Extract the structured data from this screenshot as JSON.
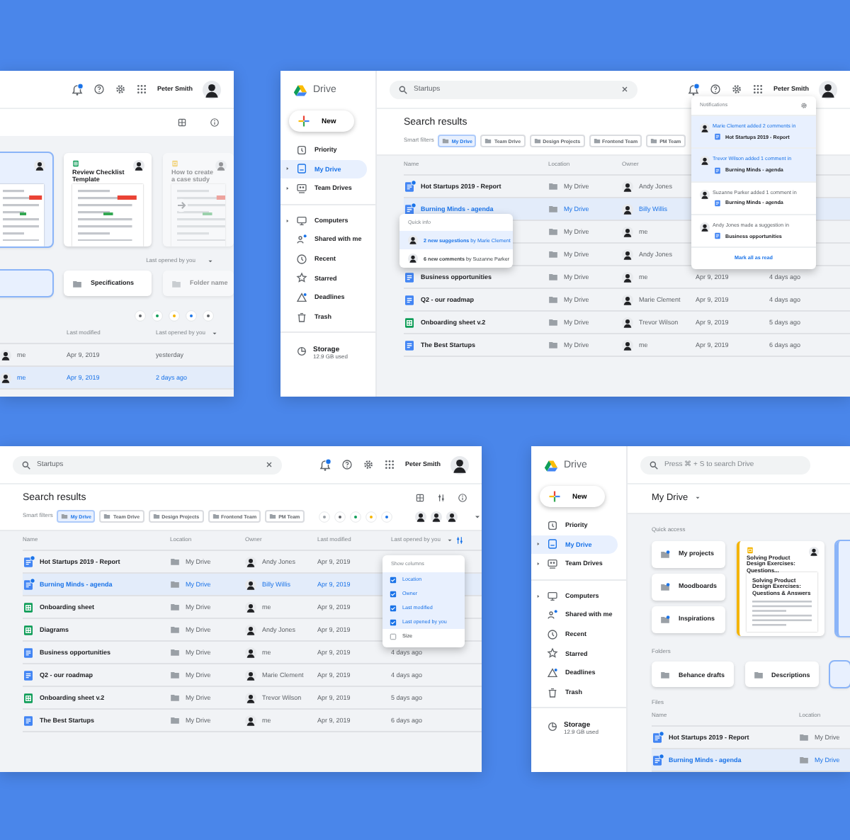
{
  "panels": [
    {
      "kind": "home_partial",
      "user": "Peter Smith",
      "cards": [
        {
          "selected": true
        },
        {
          "title": "Review Checklist Template",
          "kind": "sheet",
          "selected": false,
          "faded": false
        },
        {
          "title": "How to create a case study",
          "kind": "slides",
          "selected": false,
          "faded": true
        }
      ],
      "sort": "Last opened by you",
      "folders": [
        {
          "selected": true
        },
        {
          "name": "Specifications",
          "selected": false,
          "faded": false
        },
        {
          "name": "Folder name",
          "selected": false,
          "faded": true
        }
      ],
      "table": {
        "columns": [
          "Last modified",
          "Last opened by you"
        ],
        "rows": [
          {
            "owner": "me",
            "modified": "Apr 9, 2019",
            "opened": "yesterday",
            "selected": false
          },
          {
            "owner": "me",
            "modified": "Apr 9, 2019",
            "opened": "2 days ago",
            "selected": true
          }
        ]
      }
    },
    {
      "kind": "search_notifications",
      "user": "Peter Smith",
      "sidebar": {
        "logo": "Drive",
        "new": "New",
        "groups": [
          [
            {
              "label": "Priority",
              "selected": false,
              "expandable": false
            },
            {
              "label": "My Drive",
              "selected": true,
              "expandable": true
            },
            {
              "label": "Team Drives",
              "selected": false,
              "expandable": true
            }
          ],
          [
            {
              "label": "Computers",
              "selected": false,
              "expandable": true
            },
            {
              "label": "Shared with me",
              "selected": false,
              "expandable": false
            },
            {
              "label": "Recent",
              "selected": false,
              "expandable": false
            },
            {
              "label": "Starred",
              "selected": false,
              "expandable": false
            },
            {
              "label": "Deadlines",
              "selected": false,
              "expandable": false
            },
            {
              "label": "Trash",
              "selected": false,
              "expandable": false
            }
          ]
        ],
        "storage": "Storage",
        "storage_used": "12.9 GB used"
      },
      "search": {
        "value": "Startups"
      },
      "title": "Search results",
      "filters_label": "Smart filters",
      "chips": [
        {
          "label": "My Drive",
          "selected": true
        },
        {
          "label": "Team Drive",
          "selected": false
        },
        {
          "label": "Design Projects",
          "selected": false
        },
        {
          "label": "Frontend Team",
          "selected": false
        },
        {
          "label": "PM Team",
          "selected": false
        }
      ],
      "table": {
        "columns": [
          "Name",
          "Location",
          "Owner"
        ],
        "rows": [
          {
            "name": "Hot Startups 2019 - Report",
            "kind": "doc",
            "badge": true,
            "location": "My Drive",
            "owner": "Andy Jones",
            "selected": false
          },
          {
            "name": "Burning Minds - agenda",
            "kind": "doc",
            "badge": true,
            "location": "My Drive",
            "owner": "Billy Willis",
            "selected": true
          },
          {
            "location": "My Drive",
            "owner": "me",
            "selected": false
          },
          {
            "location": "My Drive",
            "owner": "Andy Jones",
            "selected": false
          },
          {
            "name": "Business opportunities",
            "kind": "doc",
            "badge": false,
            "location": "My Drive",
            "owner": "me",
            "modified": "Apr 9, 2019",
            "opened": "4 days ago",
            "selected": false
          },
          {
            "name": "Q2 - our roadmap",
            "kind": "doc",
            "badge": false,
            "location": "My Drive",
            "owner": "Marie Clement",
            "modified": "Apr 9, 2019",
            "opened": "4 days ago",
            "selected": false
          },
          {
            "name": "Onboarding sheet v.2",
            "kind": "sheet",
            "badge": false,
            "location": "My Drive",
            "owner": "Trevor Wilson",
            "modified": "Apr 9, 2019",
            "opened": "5 days ago",
            "selected": false
          },
          {
            "name": "The Best Startups",
            "kind": "doc",
            "badge": false,
            "location": "My Drive",
            "owner": "me",
            "modified": "Apr 9, 2019",
            "opened": "6 days ago",
            "selected": false
          }
        ]
      },
      "quick_info": {
        "title": "Quick info",
        "items": [
          {
            "text": "**2 new suggestions** by Marie Clement",
            "selected": true
          },
          {
            "text": "**6 new comments** by Suzanne Parker",
            "selected": false
          }
        ]
      },
      "notifications": {
        "title": "Notifications",
        "items": [
          {
            "text": "Marie Clement added 2 comments in",
            "file": "Hot Startups 2019 - Report",
            "unread": true
          },
          {
            "text": "Trevor Wilson added 1 comment in",
            "file": "Burning Minds - agenda",
            "unread": true
          },
          {
            "text": "Suzanne Parker added 1 comment in",
            "file": "Burning Minds - agenda",
            "unread": false
          },
          {
            "text": "Andy Jones made a suggestion in",
            "file": "Business opportunities",
            "unread": false
          }
        ],
        "action": "Mark all as read"
      }
    },
    {
      "kind": "search_columns",
      "user": "Peter Smith",
      "search": {
        "value": "Startups"
      },
      "title": "Search results",
      "filters_label": "Smart filters",
      "chips": [
        {
          "label": "My Drive",
          "selected": true
        },
        {
          "label": "Team Drive",
          "selected": false
        },
        {
          "label": "Design Projects",
          "selected": false
        },
        {
          "label": "Frontend Team",
          "selected": false
        },
        {
          "label": "PM Team",
          "selected": false
        }
      ],
      "table": {
        "columns": [
          "Name",
          "Location",
          "Owner",
          "Last modified",
          "Last opened by you"
        ],
        "rows": [
          {
            "name": "Hot Startups 2019 - Report",
            "kind": "doc",
            "badge": true,
            "location": "My Drive",
            "owner": "Andy Jones",
            "modified": "Apr 9, 2019",
            "selected": false
          },
          {
            "name": "Burning Minds - agenda",
            "kind": "doc",
            "badge": true,
            "location": "My Drive",
            "owner": "Billy Willis",
            "modified": "Apr 9, 2019",
            "selected": true
          },
          {
            "name": "Onboarding sheet",
            "kind": "sheet",
            "badge": false,
            "location": "My Drive",
            "owner": "me",
            "modified": "Apr 9, 2019",
            "selected": false
          },
          {
            "name": "Diagrams",
            "kind": "sheet",
            "badge": false,
            "location": "My Drive",
            "owner": "Andy Jones",
            "modified": "Apr 9, 2019",
            "selected": false
          },
          {
            "name": "Business opportunities",
            "kind": "doc",
            "badge": false,
            "location": "My Drive",
            "owner": "me",
            "modified": "Apr 9, 2019",
            "opened": "4 days ago",
            "selected": false
          },
          {
            "name": "Q2 - our roadmap",
            "kind": "doc",
            "badge": false,
            "location": "My Drive",
            "owner": "Marie Clement",
            "modified": "Apr 9, 2019",
            "opened": "4 days ago",
            "selected": false
          },
          {
            "name": "Onboarding sheet v.2",
            "kind": "sheet",
            "badge": false,
            "location": "My Drive",
            "owner": "Trevor Wilson",
            "modified": "Apr 9, 2019",
            "opened": "5 days ago",
            "selected": false
          },
          {
            "name": "The Best Startups",
            "kind": "doc",
            "badge": false,
            "location": "My Drive",
            "owner": "me",
            "modified": "Apr 9, 2019",
            "opened": "6 days ago",
            "selected": false
          }
        ]
      },
      "columns_menu": {
        "title": "Show columns",
        "items": [
          {
            "label": "Location",
            "checked": true
          },
          {
            "label": "Owner",
            "checked": true
          },
          {
            "label": "Last modified",
            "checked": true
          },
          {
            "label": "Last opened by you",
            "checked": true
          },
          {
            "label": "Size",
            "checked": false
          }
        ]
      }
    },
    {
      "kind": "my_drive",
      "sidebar": {
        "logo": "Drive",
        "new": "New",
        "groups": [
          [
            {
              "label": "Priority",
              "selected": false,
              "expandable": false
            },
            {
              "label": "My Drive",
              "selected": true,
              "expandable": true
            },
            {
              "label": "Team Drives",
              "selected": false,
              "expandable": true
            }
          ],
          [
            {
              "label": "Computers",
              "selected": false,
              "expandable": true
            },
            {
              "label": "Shared with me",
              "selected": false,
              "expandable": false
            },
            {
              "label": "Recent",
              "selected": false,
              "expandable": false
            },
            {
              "label": "Starred",
              "selected": false,
              "expandable": false
            },
            {
              "label": "Deadlines",
              "selected": false,
              "expandable": false
            },
            {
              "label": "Trash",
              "selected": false,
              "expandable": false
            }
          ]
        ],
        "storage": "Storage",
        "storage_used": "12.9 GB used"
      },
      "search": {
        "placeholder": "Press ⌘ + S to search Drive"
      },
      "title": "My Drive",
      "quick_label": "Quick access",
      "quick_folders": [
        "My projects",
        "Moodboards",
        "Inspirations"
      ],
      "quick_doc": {
        "title": "Solving Product Design Exercises: Questions...",
        "heading": "Solving Product Design Exercises: Questions & Answers"
      },
      "folders_label": "Folders",
      "folders": [
        "Behance drafts",
        "Descriptions"
      ],
      "files_label": "Files",
      "table": {
        "columns": [
          "Name",
          "Location"
        ],
        "rows": [
          {
            "name": "Hot Startups 2019 - Report",
            "kind": "doc",
            "badge": true,
            "location": "My Drive",
            "selected": false
          },
          {
            "name": "Burning Minds - agenda",
            "kind": "doc",
            "badge": true,
            "location": "My Drive",
            "selected": true
          }
        ]
      }
    }
  ]
}
